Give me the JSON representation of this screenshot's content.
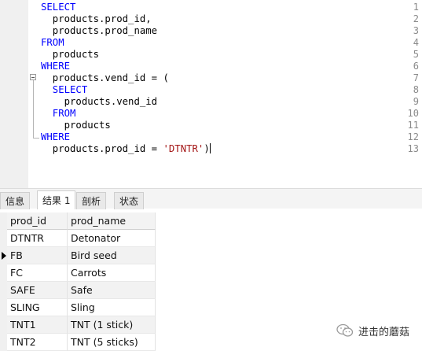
{
  "editor": {
    "line_numbers": [
      "1",
      "2",
      "3",
      "4",
      "5",
      "6",
      "7",
      "8",
      "9",
      "10",
      "11",
      "12",
      "13"
    ],
    "lines": [
      {
        "kw": "SELECT",
        "text": "",
        "str": "",
        "tail": ""
      },
      {
        "kw": "",
        "text": "  products.prod_id,",
        "str": "",
        "tail": ""
      },
      {
        "kw": "",
        "text": "  products.prod_name",
        "str": "",
        "tail": ""
      },
      {
        "kw": "FROM",
        "text": "",
        "str": "",
        "tail": ""
      },
      {
        "kw": "",
        "text": "  products",
        "str": "",
        "tail": ""
      },
      {
        "kw": "WHERE",
        "text": "",
        "str": "",
        "tail": ""
      },
      {
        "kw": "",
        "text": "  products.vend_id = (",
        "str": "",
        "tail": ""
      },
      {
        "kw": "  SELECT",
        "text": "",
        "str": "",
        "tail": ""
      },
      {
        "kw": "",
        "text": "    products.vend_id",
        "str": "",
        "tail": ""
      },
      {
        "kw": "  FROM",
        "text": "",
        "str": "",
        "tail": ""
      },
      {
        "kw": "",
        "text": "    products",
        "str": "",
        "tail": ""
      },
      {
        "kw": "WHERE",
        "text": "",
        "str": "",
        "tail": ""
      },
      {
        "kw": "",
        "text": "  products.prod_id = ",
        "str": "'DTNTR'",
        "tail": ")"
      }
    ]
  },
  "tabs": [
    "信息",
    "结果 1",
    "剖析",
    "状态"
  ],
  "active_tab_index": 1,
  "results": {
    "columns": [
      "prod_id",
      "prod_name"
    ],
    "rows": [
      [
        "DTNTR",
        "Detonator"
      ],
      [
        "FB",
        "Bird seed"
      ],
      [
        "FC",
        "Carrots"
      ],
      [
        "SAFE",
        "Safe"
      ],
      [
        "SLING",
        "Sling"
      ],
      [
        "TNT1",
        "TNT (1 stick)"
      ],
      [
        "TNT2",
        "TNT (5 sticks)"
      ]
    ],
    "current_row_index": 1
  },
  "watermark": {
    "text": "进击的蘑菇",
    "icon": "wechat-icon",
    "color": "#9a9a9a"
  }
}
